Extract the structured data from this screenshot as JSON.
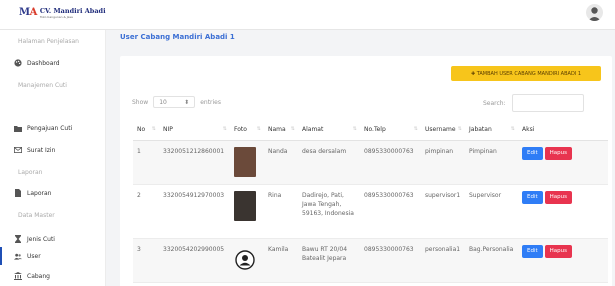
{
  "brand": {
    "mark": "MA",
    "name": "CV. Mandiri Abadi",
    "tagline": "Toko bangunan & Jasa"
  },
  "sidebar": {
    "items": [
      {
        "label": "Halaman Penjelasan",
        "type": "heading",
        "icon": ""
      },
      {
        "label": "Dashboard",
        "type": "link",
        "icon": "palette-icon"
      },
      {
        "label": "Manajemen Cuti",
        "type": "heading",
        "icon": ""
      },
      {
        "label": "Pengajuan Cuti",
        "type": "link",
        "icon": "folder-icon"
      },
      {
        "label": "Surat Izin",
        "type": "link",
        "icon": "mail-icon"
      },
      {
        "label": "Laporan",
        "type": "heading",
        "icon": ""
      },
      {
        "label": "Laporan",
        "type": "link",
        "icon": "file-icon"
      },
      {
        "label": "Data Master",
        "type": "heading",
        "icon": ""
      },
      {
        "label": "Jenis Cuti",
        "type": "link",
        "icon": "hourglass-icon"
      },
      {
        "label": "User",
        "type": "link",
        "icon": "users-icon",
        "active": true
      },
      {
        "label": "Cabang",
        "type": "link",
        "icon": "bank-icon"
      }
    ]
  },
  "page": {
    "title": "User Cabang Mandiri Abadi 1"
  },
  "toolbar": {
    "add_label": "✚ TAMBAH USER CABANG MANDIRI ABADI 1"
  },
  "length": {
    "show": "Show",
    "value": "10",
    "entries": "entries"
  },
  "search": {
    "label": "Search:",
    "value": ""
  },
  "table": {
    "headers": [
      "No",
      "NIP",
      "Foto",
      "Nama",
      "Alamat",
      "No.Telp",
      "Username",
      "Jabatan",
      "Aksi"
    ],
    "rows": [
      {
        "no": "1",
        "nip": "3320051212860001",
        "foto": "photo",
        "nama": "Nanda",
        "alamat": "desa dersalam",
        "telp": "0895330000763",
        "username": "pimpinan",
        "jabatan": "Pimpinan"
      },
      {
        "no": "2",
        "nip": "3320054912970003",
        "foto": "photo",
        "nama": "Rina",
        "alamat": "Dadirejo, Pati, Jawa Tengah, 59163, Indonesia",
        "telp": "0895330000763",
        "username": "supervisor1",
        "jabatan": "Supervisor"
      },
      {
        "no": "3",
        "nip": "3320054202990005",
        "foto": "placeholder",
        "nama": "Kamila",
        "alamat": "Bawu RT 20/04 Batealit Jepara",
        "telp": "0895330000763",
        "username": "personalia1",
        "jabatan": "Bag.Personalia"
      }
    ],
    "edit_label": "Edit",
    "delete_label": "Hapus"
  },
  "colors": {
    "accent": "#3b6fd4",
    "add_button": "#f7c51b",
    "edit": "#2f7df6",
    "delete": "#e8344f",
    "active_bar": "#1f4fb5"
  }
}
